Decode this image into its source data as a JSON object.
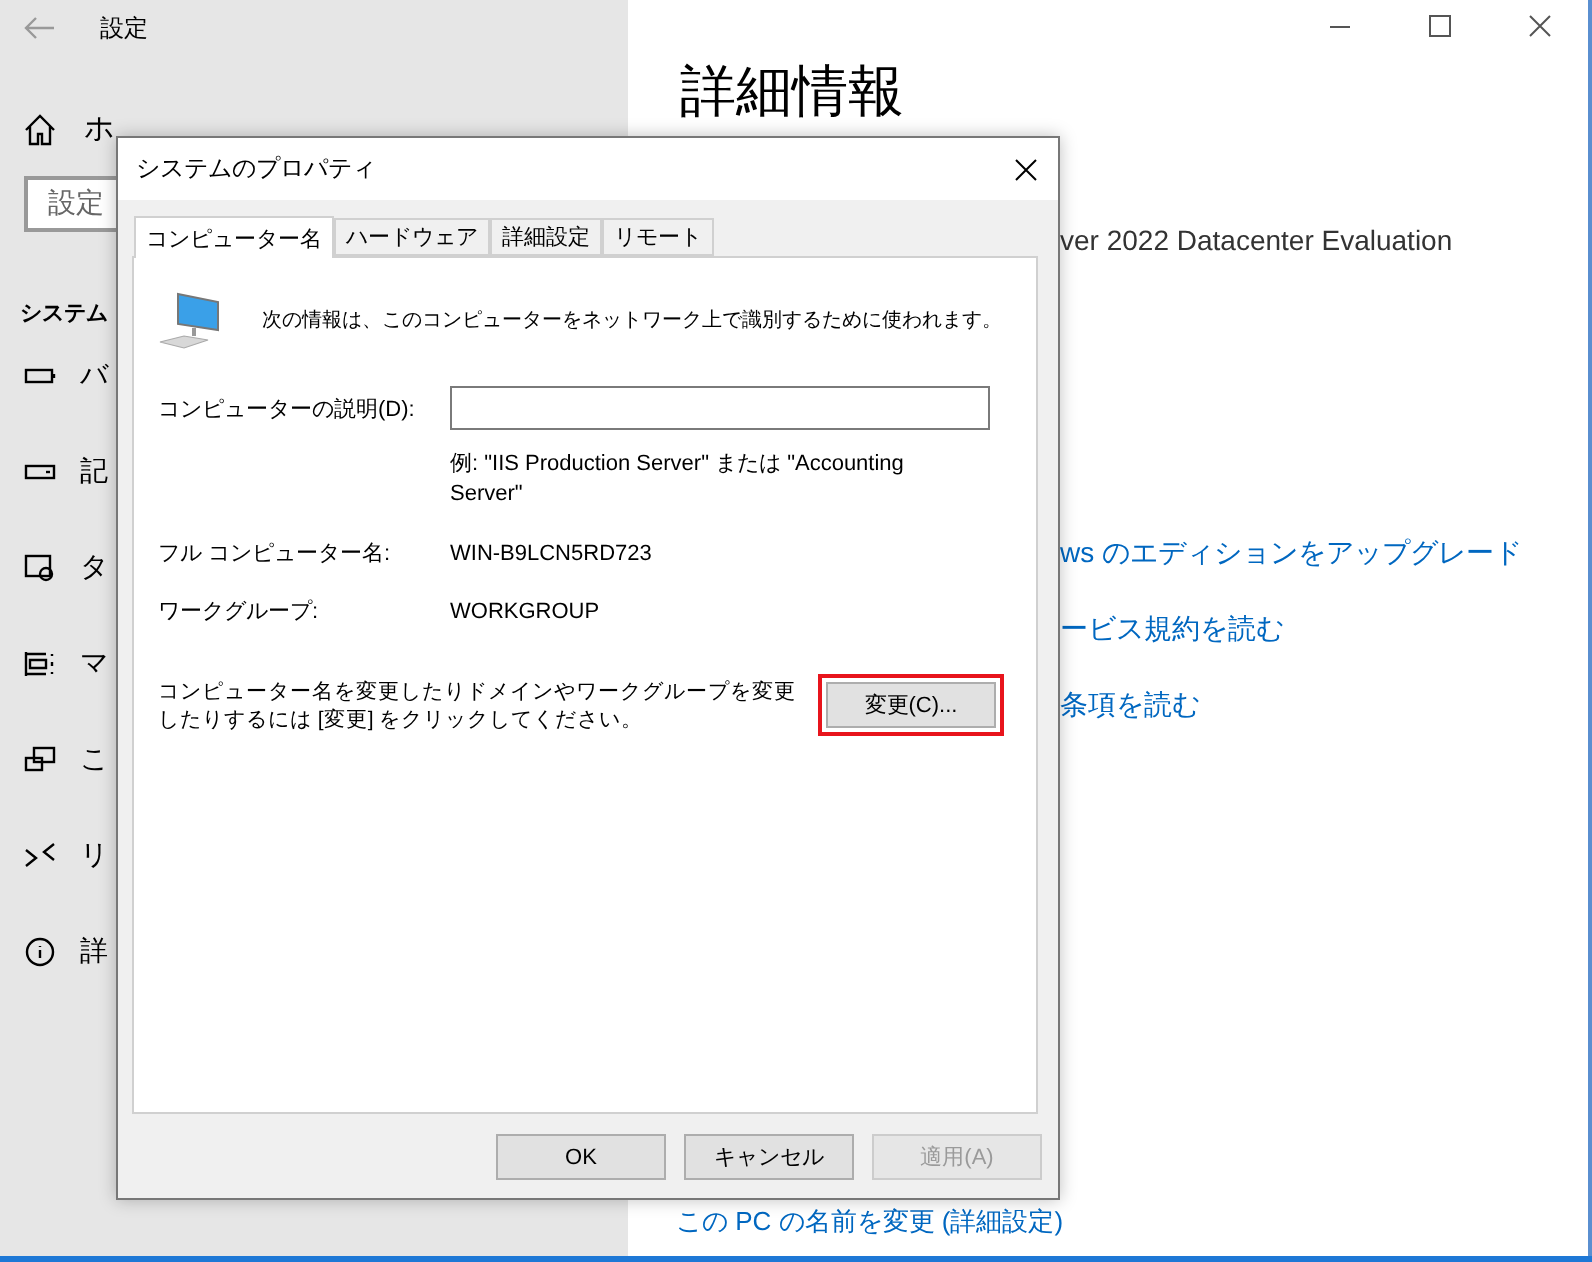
{
  "settings_window": {
    "title": "設定",
    "sidebar": {
      "home": "ホ",
      "search": {
        "placeholder": "設定"
      },
      "section": "システム",
      "items": [
        {
          "kind": "battery",
          "label": "バ"
        },
        {
          "kind": "storage",
          "label": "記"
        },
        {
          "kind": "tablet",
          "label": "タ"
        },
        {
          "kind": "multitask",
          "label": "マ"
        },
        {
          "kind": "project",
          "label": "こ"
        },
        {
          "kind": "remote",
          "label": "リ"
        },
        {
          "kind": "info",
          "label": "詳"
        }
      ]
    },
    "content": {
      "heading": "詳細情報",
      "edition": "ver 2022 Datacenter Evaluation",
      "links": [
        "ws のエディションをアップグレード",
        "ービス規約を読む",
        "条項を読む"
      ],
      "bottom_link": "この PC の名前を変更 (詳細設定)"
    }
  },
  "dialog": {
    "title": "システムのプロパティ",
    "tabs": [
      {
        "label": "コンピューター名",
        "selected": true
      },
      {
        "label": "ハードウェア",
        "selected": false
      },
      {
        "label": "詳細設定",
        "selected": false
      },
      {
        "label": "リモート",
        "selected": false
      }
    ],
    "intro": "次の情報は、このコンピューターをネットワーク上で識別するために使われます。",
    "description_label": "コンピューターの説明(D):",
    "example": "例: \"IIS Production Server\" または \"Accounting Server\"",
    "fields": [
      {
        "label": "フル コンピューター名:",
        "value": "WIN-B9LCN5RD723"
      },
      {
        "label": "ワークグループ:",
        "value": "WORKGROUP"
      }
    ],
    "change_text": "コンピューター名を変更したりドメインやワークグループを変更したりするには [変更] をクリックしてください。",
    "change_button": {
      "label": "変更(C)...",
      "highlighted": true
    },
    "buttons": [
      {
        "label": "OK",
        "disabled": false
      },
      {
        "label": "キャンセル",
        "disabled": false
      },
      {
        "label": "適用(A)",
        "disabled": true
      }
    ]
  }
}
